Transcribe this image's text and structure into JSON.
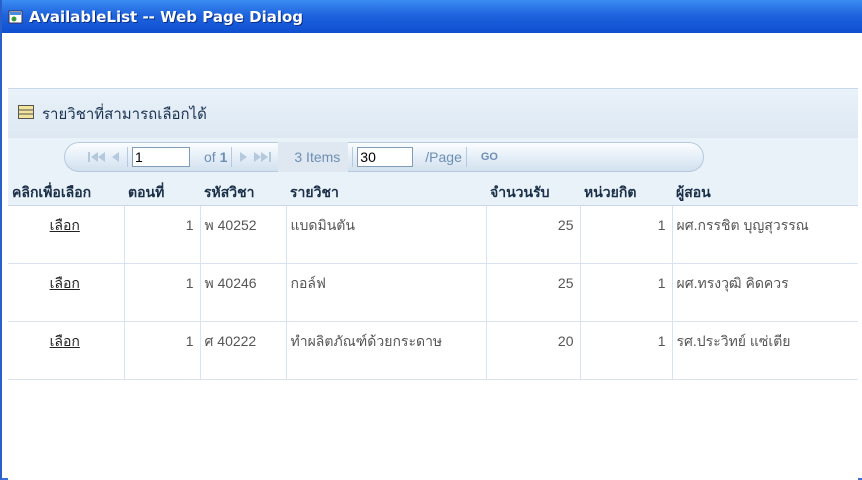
{
  "window": {
    "title": "AvailableList -- Web Page Dialog"
  },
  "panel": {
    "title": "รายวิชาที่สามารถเลือกได้"
  },
  "pager": {
    "page_value": "1",
    "of_label": "of",
    "total_pages": "1",
    "items_text": "3 Items",
    "page_size_value": "30",
    "per_page_label": "/Page",
    "go_label": "GO"
  },
  "table": {
    "headers": {
      "select": "คลิกเพื่อเลือก",
      "section": "ตอนที่",
      "course_code": "รหัสวิชา",
      "course_name": "รายวิชา",
      "capacity": "จำนวนรับ",
      "credit": "หน่วยกิต",
      "instructor": "ผู้สอน"
    },
    "rows": [
      {
        "select": "เลือก",
        "section": "1",
        "course_code": "พ 40252",
        "course_name": "แบดมินตัน",
        "capacity": "25",
        "credit": "1",
        "instructor": "ผศ.กรรชิต บุญสุวรรณ"
      },
      {
        "select": "เลือก",
        "section": "1",
        "course_code": "พ 40246",
        "course_name": "กอล์ฟ",
        "capacity": "25",
        "credit": "1",
        "instructor": "ผศ.ทรงวุฒิ คิดควร"
      },
      {
        "select": "เลือก",
        "section": "1",
        "course_code": "ศ 40222",
        "course_name": "ทำผลิตภัณฑ์ด้วยกระดาษ",
        "capacity": "20",
        "credit": "1",
        "instructor": "รศ.ประวิทย์ แซ่เตีย"
      }
    ]
  }
}
